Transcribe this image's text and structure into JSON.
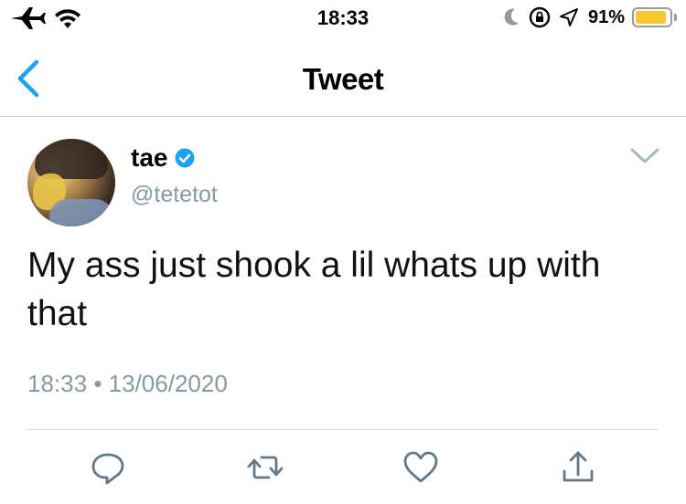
{
  "status_bar": {
    "time": "18:33",
    "battery_percent": "91%",
    "battery_level": 0.91,
    "icons": [
      "airplane-icon",
      "wifi-icon",
      "moon-icon",
      "orientation-lock-icon",
      "location-icon",
      "battery-icon"
    ],
    "battery_color": "#f7c531"
  },
  "nav": {
    "title": "Tweet",
    "back_icon": "chevron-left-icon",
    "accent": "#1da1f2"
  },
  "tweet": {
    "display_name": "tae",
    "verified": true,
    "handle": "@tetetot",
    "text": "My ass just shook a lil whats up with that",
    "time": "18:33",
    "separator": "•",
    "date": "13/06/2020"
  },
  "actions": [
    "reply-icon",
    "retweet-icon",
    "like-icon",
    "share-icon"
  ],
  "colors": {
    "secondary_text": "#8899a6",
    "icon_gray": "#657786",
    "verified_blue": "#1da1f2"
  }
}
